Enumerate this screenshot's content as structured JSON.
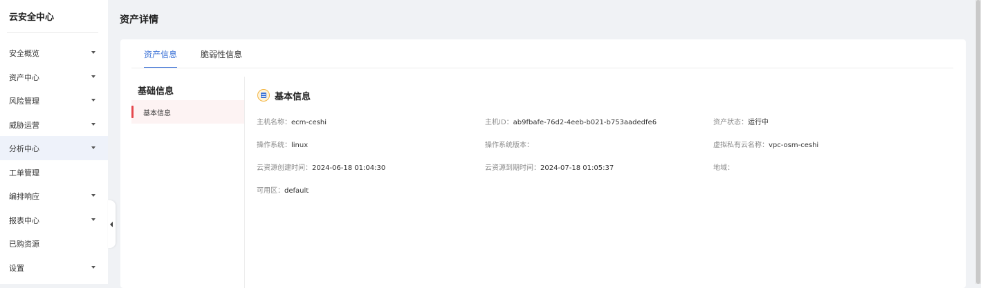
{
  "sidebar": {
    "title": "云安全中心",
    "items": [
      {
        "label": "安全概览"
      },
      {
        "label": "资产中心"
      },
      {
        "label": "风险管理"
      },
      {
        "label": "威胁运营"
      },
      {
        "label": "分析中心"
      },
      {
        "label": "工单管理"
      },
      {
        "label": "编排响应"
      },
      {
        "label": "报表中心"
      },
      {
        "label": "已购资源"
      },
      {
        "label": "设置"
      }
    ]
  },
  "page": {
    "title": "资产详情"
  },
  "tabs": [
    {
      "label": "资产信息",
      "active": true
    },
    {
      "label": "脆弱性信息",
      "active": false
    }
  ],
  "left_nav": {
    "title": "基础信息",
    "items": [
      {
        "label": "基本信息"
      }
    ]
  },
  "section": {
    "title": "基本信息",
    "icon": "list-icon",
    "fields": [
      {
        "key": "主机名称：",
        "value": "ecm-ceshi"
      },
      {
        "key": "主机ID：",
        "value": "ab9fbafe-76d2-4eeb-b021-b753aadedfe6"
      },
      {
        "key": "资产状态：",
        "value": "运行中"
      },
      {
        "key": "操作系统：",
        "value": "linux"
      },
      {
        "key": "操作系统版本：",
        "value": ""
      },
      {
        "key": "虚拟私有云名称：",
        "value": "vpc-osm-ceshi"
      },
      {
        "key": "云资源创建时间：",
        "value": "2024-06-18 01:04:30"
      },
      {
        "key": "云资源到期时间：",
        "value": "2024-07-18 01:05:37"
      },
      {
        "key": "地域：",
        "value": ""
      },
      {
        "key": "可用区：",
        "value": "default"
      }
    ]
  },
  "colors": {
    "accent": "#3d73d7",
    "active_marker": "#e5484d",
    "background": "#f0f2f5"
  }
}
